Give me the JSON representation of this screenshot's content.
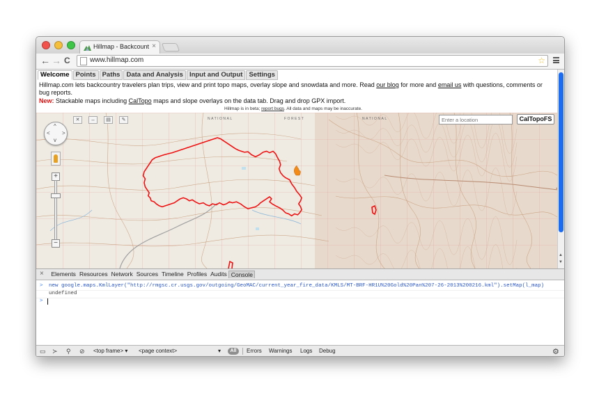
{
  "browser": {
    "tab_title": "Hillmap - Backcountry Maps",
    "tab_close": "×",
    "url": "www.hillmap.com",
    "nav": {
      "back": "←",
      "forward": "→",
      "reload": "C"
    },
    "star": "☆"
  },
  "site": {
    "tabs": [
      {
        "label": "Welcome",
        "active": true
      },
      {
        "label": "Points"
      },
      {
        "label": "Paths"
      },
      {
        "label": "Data and Analysis"
      },
      {
        "label": "Input and Output"
      },
      {
        "label": "Settings"
      }
    ],
    "intro": {
      "text1": "Hillmap.com lets backcountry travelers plan trips, view and print topo maps, overlay slope and snowdata and more. Read ",
      "link1": "our blog",
      "text2": " for more and ",
      "link2": "email us",
      "text3": " with questions, comments or bug reports."
    },
    "news": {
      "label": "New:",
      "text1": " Stackable maps including ",
      "link": "CalTopo",
      "text2": " maps and slope overlays on the data tab. Drag and drop GPX import."
    },
    "beta": {
      "text1": "Hillmap is in beta; ",
      "link": "report bugs",
      "text2": ". All data and maps may be inaccurate."
    }
  },
  "map": {
    "location_placeholder": "Enter a location",
    "layer_button": "CalTopoFS",
    "fire_color": "#ee1111",
    "labels": [
      "NATIONAL",
      "FOREST",
      "NATIONAL"
    ],
    "tools": [
      "✕",
      "↔",
      "▤",
      "✎"
    ]
  },
  "devtools": {
    "close": "×",
    "tabs": [
      "Elements",
      "Resources",
      "Network",
      "Sources",
      "Timeline",
      "Profiles",
      "Audits",
      "Console"
    ],
    "active_tab": "Console",
    "console": {
      "command": "new google.maps.KmlLayer(\"http://rmgsc.cr.usgs.gov/outgoing/GeoMAC/current_year_fire_data/KMLS/MT-BRF-HR1U%20Gold%20Pan%207-26-2013%200216.kml\").setMap(l_map)",
      "result": "undefined",
      "prompt": ">"
    },
    "status": {
      "frame": "<top frame>",
      "context": "<page context>",
      "all": "All",
      "filters": [
        "Errors",
        "Warnings",
        "Logs",
        "Debug"
      ]
    }
  }
}
